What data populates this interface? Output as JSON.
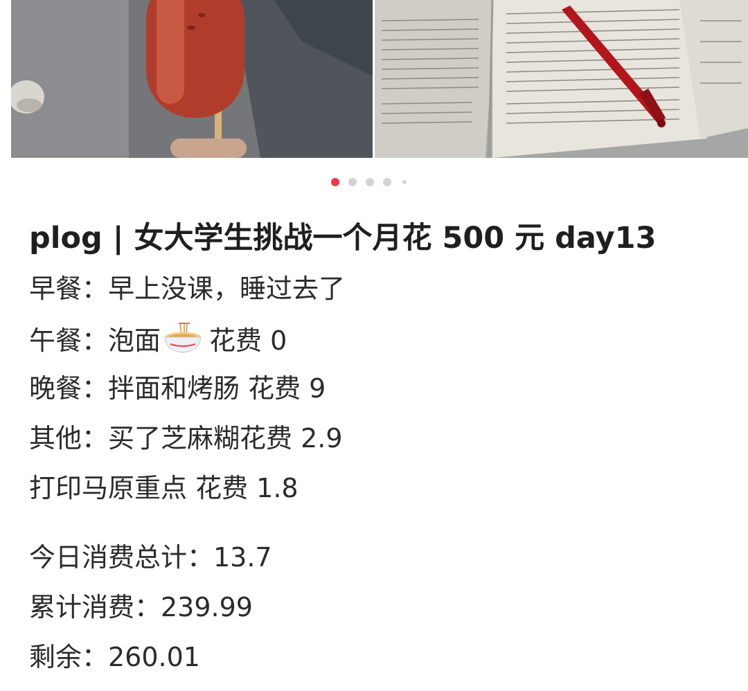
{
  "carousel": {
    "photos": [
      "photo-sausage",
      "photo-book-and-pen"
    ],
    "page_count": 5,
    "active_index": 0,
    "active_color": "#f0364b",
    "inactive_color": "#d3d3d3"
  },
  "post": {
    "title": "plog | 女大学生挑战一个月花 500 元 day13",
    "lines": [
      "早餐：早上没课，睡过去了",
      "午餐：泡面",
      "花费 0",
      "晚餐：拌面和烤肠 花费 9",
      "其他：买了芝麻糊花费 2.9",
      "打印马原重点 花费 1.8"
    ],
    "lunch_icon": "noodle-bowl-icon",
    "summary": [
      "今日消费总计：13.7",
      "累计消费：239.99",
      "剩余：260.01"
    ]
  }
}
